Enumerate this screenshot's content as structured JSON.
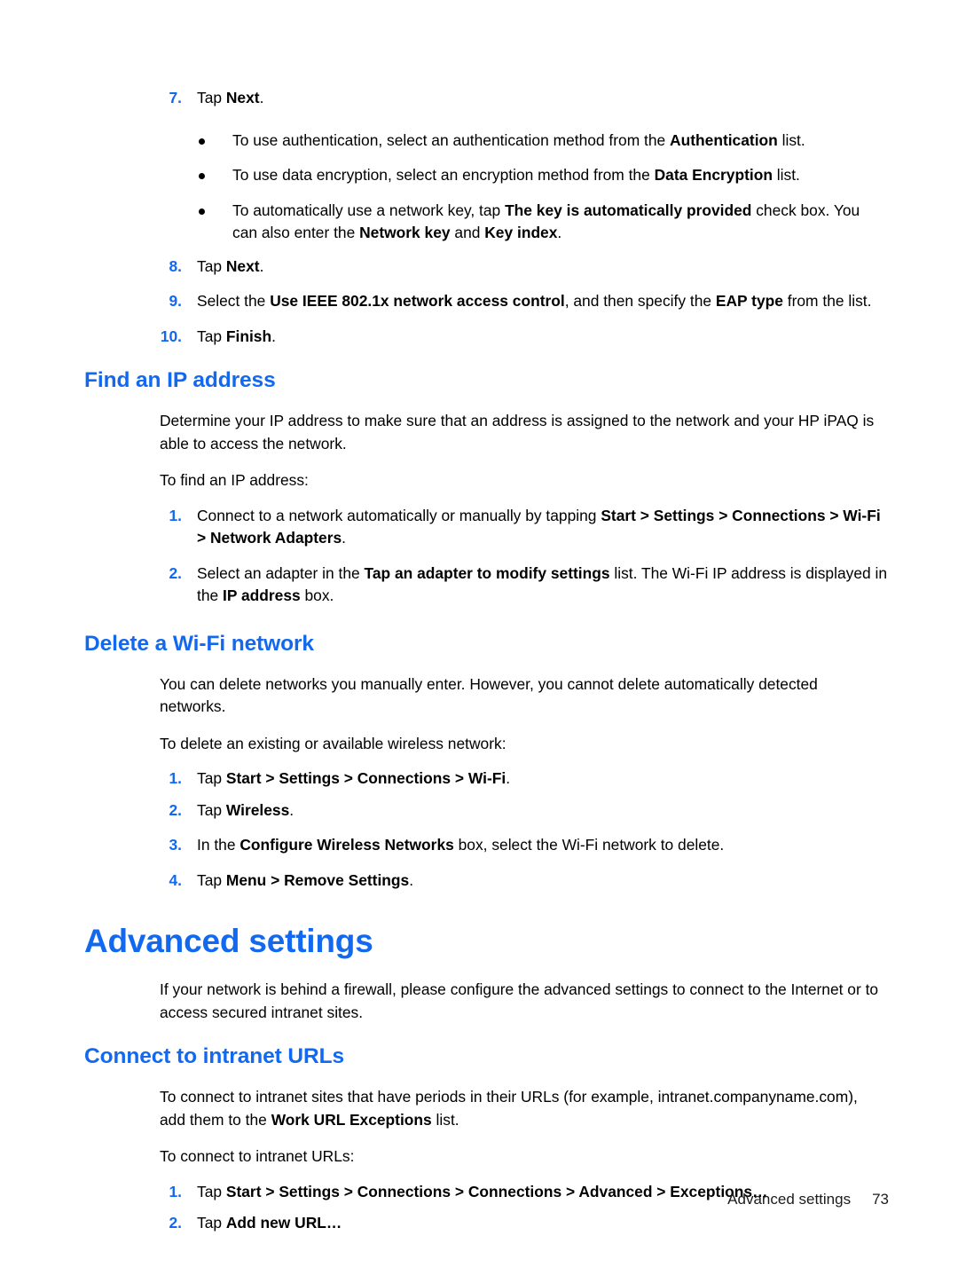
{
  "document": {
    "footer": {
      "section_label": "Advanced settings",
      "page_number": "73"
    },
    "accent_color": "#1269f0",
    "text_color": "#000000"
  },
  "blocks": {
    "step7": {
      "number": "7.",
      "text_before": "Tap ",
      "bold": "Next",
      "text_after": "."
    },
    "bullet1": {
      "a": "To use authentication, select an authentication method from the ",
      "b": "Authentication",
      "c": " list."
    },
    "bullet2": {
      "a": "To use data encryption, select an encryption method from the ",
      "b": "Data Encryption",
      "c": " list."
    },
    "bullet3": {
      "a": "To automatically use a network key, tap ",
      "b": "The key is automatically provided",
      "c": " check box. You can also enter the ",
      "d": "Network key",
      "e": " and ",
      "f": "Key index",
      "g": "."
    },
    "step8": {
      "number": "8.",
      "text_before": "Tap ",
      "bold": "Next",
      "text_after": "."
    },
    "step9": {
      "number": "9.",
      "a": "Select the ",
      "b": "Use IEEE 802.1x network access control",
      "c": ", and then specify the ",
      "d": "EAP type",
      "e": " from the list."
    },
    "step10": {
      "number": "10.",
      "text_before": "Tap ",
      "bold": "Finish",
      "text_after": "."
    },
    "h2_find_ip": "Find an IP address",
    "p_find_ip_intro": "Determine your IP address to make sure that an address is assigned to the network and your HP iPAQ is able to access the network.",
    "p_find_ip_lead": "To find an IP address:",
    "find_step1": {
      "number": "1.",
      "a": "Connect to a network automatically or manually by tapping ",
      "b": "Start > Settings > Connections > Wi-Fi > Network Adapters",
      "c": "."
    },
    "find_step2": {
      "number": "2.",
      "a": "Select an adapter in the ",
      "b": "Tap an adapter to modify settings",
      "c": " list. The Wi-Fi IP address is displayed in the ",
      "d": "IP address",
      "e": " box."
    },
    "h2_delete_wifi": "Delete a Wi-Fi network",
    "p_delete_intro": "You can delete networks you manually enter. However, you cannot delete automatically detected networks.",
    "p_delete_lead": "To delete an existing or available wireless network:",
    "del_step1": {
      "number": "1.",
      "a": "Tap ",
      "b": "Start > Settings > Connections > Wi-Fi",
      "c": "."
    },
    "del_step2": {
      "number": "2.",
      "a": "Tap ",
      "b": "Wireless",
      "c": "."
    },
    "del_step3": {
      "number": "3.",
      "a": "In the ",
      "b": "Configure Wireless Networks",
      "c": " box, select the Wi-Fi network to delete."
    },
    "del_step4": {
      "number": "4.",
      "a": "Tap ",
      "b": "Menu > Remove Settings",
      "c": "."
    },
    "h1_advanced_settings": "Advanced settings",
    "p_advanced_intro": "If your network is behind a firewall, please configure the advanced settings to connect to the Internet or to access secured intranet sites.",
    "h2_connect_intranet": "Connect to intranet URLs",
    "p_intranet_intro_a": "To connect to intranet sites that have periods in their URLs (for example, intranet.companyname.com), add them to the ",
    "p_intranet_intro_b": "Work URL Exceptions",
    "p_intranet_intro_c": " list.",
    "p_intranet_lead": "To connect to intranet URLs:",
    "intra_step1": {
      "number": "1.",
      "a": "Tap ",
      "b": "Start > Settings > Connections > Connections > Advanced > Exceptions…"
    },
    "intra_step2": {
      "number": "2.",
      "a": "Tap ",
      "b": "Add new URL…"
    }
  }
}
